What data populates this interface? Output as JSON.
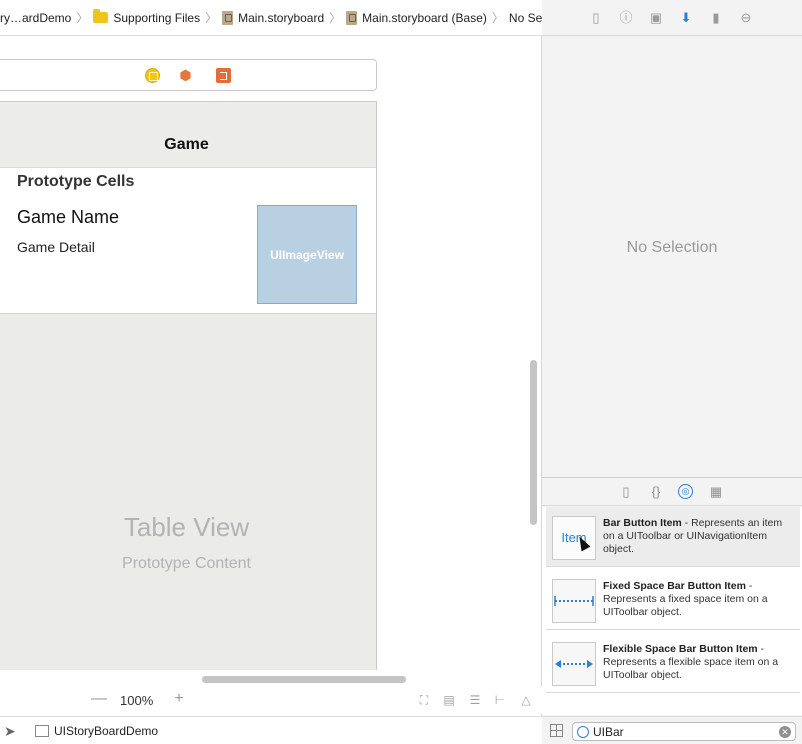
{
  "jumpbar": {
    "crumbs": [
      "ry…ardDemo",
      "Supporting Files",
      "Main.storyboard",
      "Main.storyboard (Base)",
      "No Selection"
    ]
  },
  "scene": {
    "nav_title": "Game",
    "section_header": "Prototype Cells",
    "cell_title": "Game Name",
    "cell_detail": "Game Detail",
    "image_view_label": "UIImageView",
    "table_view_title": "Table View",
    "table_view_subtitle": "Prototype Content"
  },
  "canvas_bar": {
    "zoom_out": "—",
    "zoom_level": "100%",
    "zoom_in": "+"
  },
  "statusbar": {
    "label": "UIStoryBoardDemo"
  },
  "inspector": {
    "no_selection": "No Selection"
  },
  "library": {
    "items": [
      {
        "thumb_label": "Item",
        "name": "Bar Button Item",
        "description": " - Represents an item on a UIToolbar or UINavigationItem object."
      },
      {
        "thumb_label": "",
        "name": "Fixed Space Bar Button Item",
        "description": " - Represents a fixed space item on a UIToolbar object."
      },
      {
        "thumb_label": "",
        "name": "Flexible Space Bar Button Item",
        "description": " - Represents a flexible space item on a UIToolbar object."
      }
    ],
    "filter_value": "UIBar"
  },
  "colors": {
    "accent": "#2d7fd6",
    "image_view_bg": "#b9d0e3",
    "folder": "#f2c419"
  }
}
